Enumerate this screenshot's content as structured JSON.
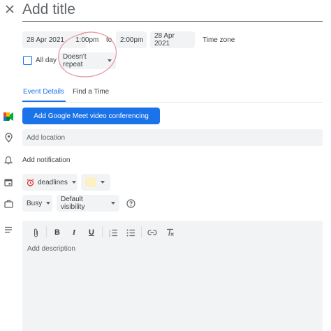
{
  "header": {
    "title_placeholder": "Add title"
  },
  "datetime": {
    "start_date": "28 Apr 2021",
    "start_time": "1:00pm",
    "to": "to",
    "end_time": "2:00pm",
    "end_date": "28 Apr 2021",
    "time_zone": "Time zone",
    "all_day": "All day",
    "repeat": "Doesn't repeat"
  },
  "tabs": {
    "event_details": "Event Details",
    "find_a_time": "Find a Time"
  },
  "meet": {
    "button": "Add Google Meet video conferencing"
  },
  "location": {
    "placeholder": "Add location"
  },
  "notification": {
    "label": "Add notification"
  },
  "calendar": {
    "name": "deadlines"
  },
  "availability": {
    "status": "Busy",
    "visibility": "Default visibility"
  },
  "description": {
    "placeholder": "Add description"
  },
  "colors": {
    "accent": "#1a73e8",
    "field_bg": "#f1f3f4",
    "annotation": "#e8a0a8",
    "event_color": "#fdf0c4"
  }
}
